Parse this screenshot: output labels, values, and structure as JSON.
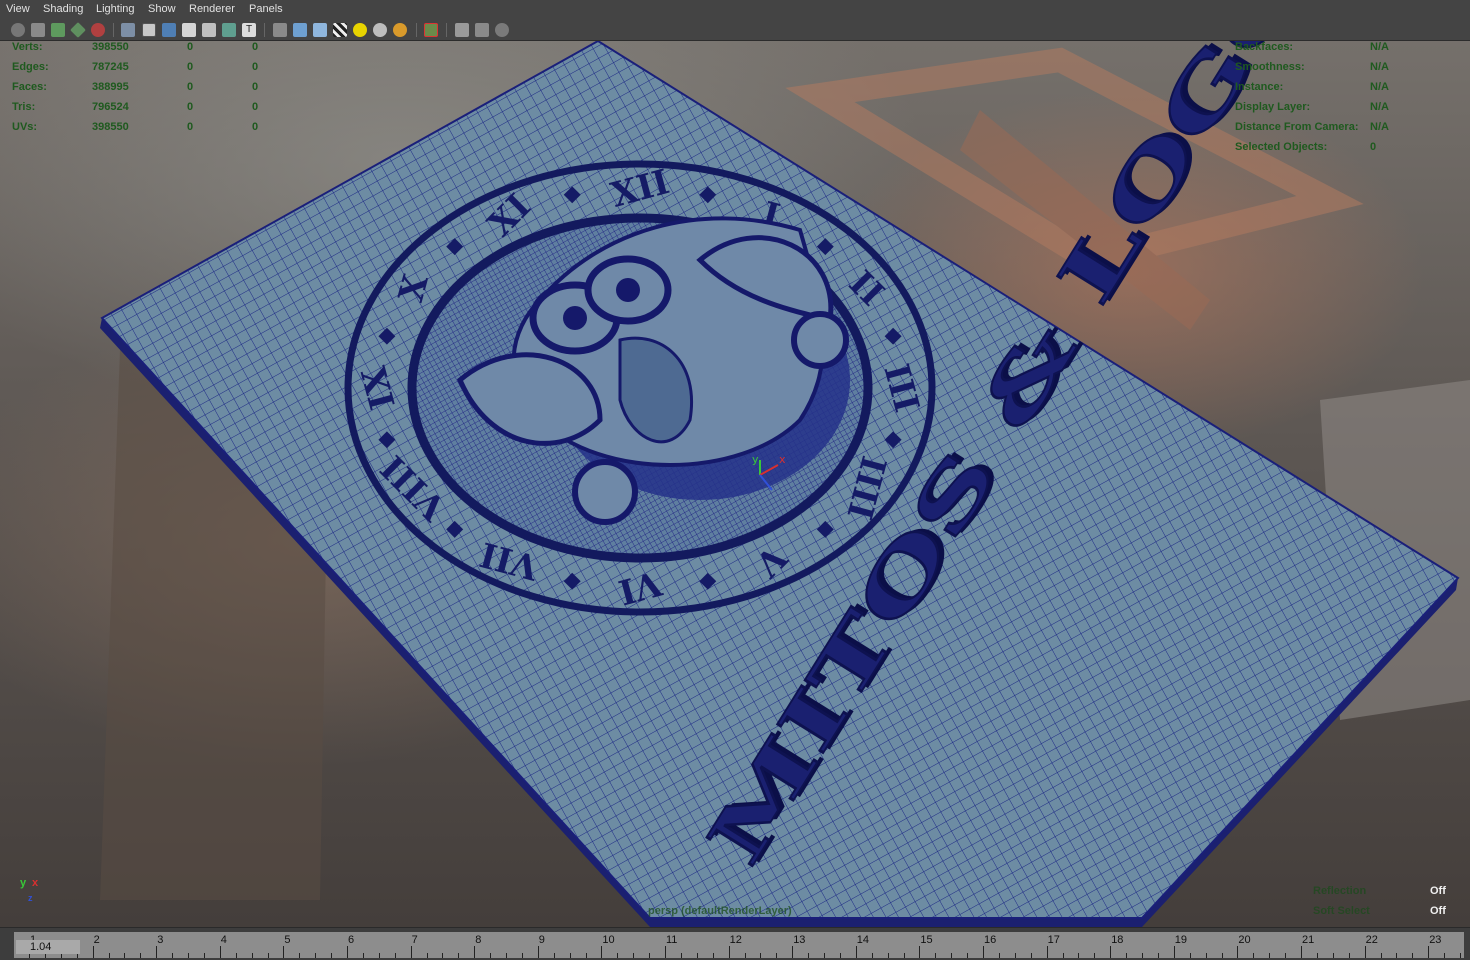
{
  "menu": {
    "items": [
      "View",
      "Shading",
      "Lighting",
      "Show",
      "Renderer",
      "Panels"
    ]
  },
  "toolbar": {
    "icons": [
      "camera-icon",
      "camera-attributes-icon",
      "bookmark-icon",
      "image-plane-icon",
      "film-gate-icon",
      "grid-icon",
      "wireframe-icon",
      "smooth-shade-icon",
      "flat-shade-icon",
      "bounding-box-icon",
      "use-default-material-icon",
      "texture-icon",
      "xray-icon",
      "cube-wire-icon",
      "cube-shaded-icon",
      "cube-textured-icon",
      "checker-icon",
      "light-default-icon",
      "light-all-icon",
      "light-bulb-icon",
      "isolate-select-icon",
      "cube-outline-icon",
      "two-cubes-icon",
      "share-icon"
    ]
  },
  "hud_left": {
    "rows": [
      {
        "label": "Verts:",
        "total": "398550",
        "selected": "0",
        "selected2": "0"
      },
      {
        "label": "Edges:",
        "total": "787245",
        "selected": "0",
        "selected2": "0"
      },
      {
        "label": "Faces:",
        "total": "388995",
        "selected": "0",
        "selected2": "0"
      },
      {
        "label": "Tris:",
        "total": "796524",
        "selected": "0",
        "selected2": "0"
      },
      {
        "label": "UVs:",
        "total": "398550",
        "selected": "0",
        "selected2": "0"
      }
    ]
  },
  "hud_right": {
    "rows": [
      {
        "label": "Backfaces:",
        "value": "N/A"
      },
      {
        "label": "Smoothness:",
        "value": "N/A"
      },
      {
        "label": "Instance:",
        "value": "N/A"
      },
      {
        "label": "Display Layer:",
        "value": "N/A"
      },
      {
        "label": "Distance From Camera:",
        "value": "N/A"
      },
      {
        "label": "Selected Objects:",
        "value": "0"
      }
    ]
  },
  "hud_bottom": {
    "camera": "persp (defaultRenderLayer)",
    "reflection_label": "Reflection",
    "reflection_value": "Off",
    "soft_select_label": "Soft Select",
    "soft_select_value": "Off"
  },
  "scene": {
    "plate_text": "MITOS & LOGOS",
    "clock_numerals": [
      "I",
      "II",
      "III",
      "IIII",
      "V",
      "VI",
      "VII",
      "VIII",
      "IX",
      "X",
      "XI",
      "XII"
    ],
    "mesh_color": "#1a1a78",
    "plate_color": "#6c8aa0"
  },
  "axis": {
    "y": "y",
    "x": "x",
    "z": "z"
  },
  "timeline": {
    "frames": [
      "1",
      "2",
      "3",
      "4",
      "5",
      "6",
      "7",
      "8",
      "9",
      "10",
      "11",
      "12",
      "13",
      "14",
      "15",
      "16",
      "17",
      "18",
      "19",
      "20",
      "21",
      "22",
      "23"
    ],
    "current": "1.04"
  }
}
